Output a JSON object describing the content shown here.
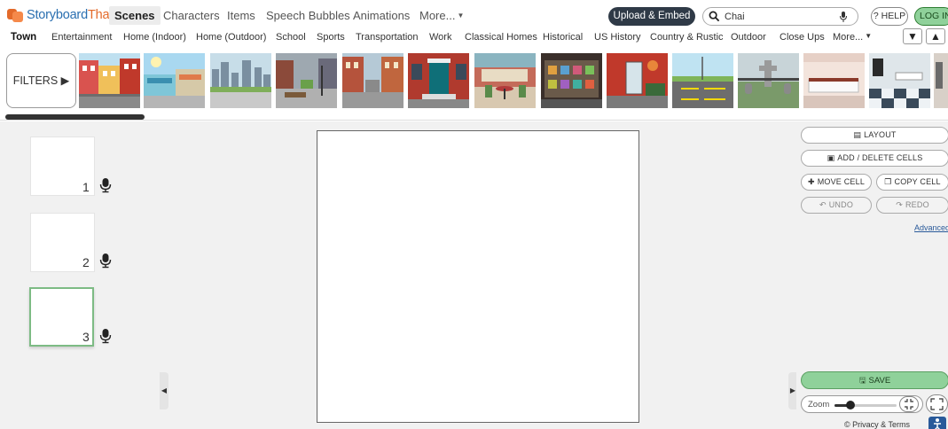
{
  "logo": {
    "text_part1": "Storyboard",
    "text_part2": "That"
  },
  "main_tabs": [
    {
      "label": "Scenes",
      "active": true
    },
    {
      "label": "Characters"
    },
    {
      "label": "Items"
    },
    {
      "label": "Speech Bubbles"
    },
    {
      "label": "Animations"
    },
    {
      "label": "More...",
      "has_caret": true
    }
  ],
  "header": {
    "upload_label": "Upload & Embed",
    "search_value": "Chai",
    "search_placeholder": "Search",
    "help_label": "HELP",
    "login_label": "LOG IN"
  },
  "categories": [
    {
      "label": "Town",
      "active": true
    },
    {
      "label": "Entertainment"
    },
    {
      "label": "Home (Indoor)"
    },
    {
      "label": "Home (Outdoor)"
    },
    {
      "label": "School"
    },
    {
      "label": "Sports"
    },
    {
      "label": "Transportation"
    },
    {
      "label": "Work"
    },
    {
      "label": "Classical Homes"
    },
    {
      "label": "Historical"
    },
    {
      "label": "US History"
    },
    {
      "label": "Country & Rustic"
    },
    {
      "label": "Outdoor"
    },
    {
      "label": "Close Ups"
    },
    {
      "label": "More..."
    }
  ],
  "filters_label": "FILTERS",
  "scene_thumbnails": [
    "town-row-houses",
    "town-storefronts",
    "city-skyline-plaza",
    "park-street",
    "brick-street",
    "townhouse-door",
    "cafe-patio",
    "shop-window",
    "alley-door",
    "parking-lot",
    "cemetery",
    "store-counter",
    "clinic-room"
  ],
  "cells": [
    {
      "number": "1",
      "selected": false
    },
    {
      "number": "2",
      "selected": false
    },
    {
      "number": "3",
      "selected": true
    }
  ],
  "tools": {
    "layout": "LAYOUT",
    "add_delete": "ADD / DELETE CELLS",
    "move_cell": "MOVE CELL",
    "copy_cell": "COPY CELL",
    "undo": "UNDO",
    "redo": "REDO",
    "advanced": "Advanced",
    "save": "SAVE"
  },
  "zoom": {
    "label": "Zoom",
    "level_fraction": 0.25
  },
  "footer": {
    "privacy": "© Privacy & Terms"
  },
  "colors": {
    "brand_blue": "#2a6fb0",
    "brand_orange": "#e36a2a",
    "save_green": "#8fd19a",
    "upload_dark": "#2f3a47"
  }
}
